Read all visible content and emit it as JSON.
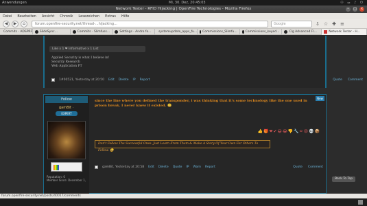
{
  "system": {
    "left_label": "Anwendungen",
    "clock": "Mi, 30. Dez, 20:45:03",
    "tray": "⚇ ⚍ ♪ ⏻"
  },
  "window": {
    "title": "Network Tester - RFID Hijacking | OpenFire Technologies - Mozilla Firefox"
  },
  "menu": [
    "Datei",
    "Bearbeiten",
    "Ansicht",
    "Chronik",
    "Lesezeichen",
    "Extras",
    "Hilfe"
  ],
  "nav": {
    "url": "forum.openfire-security.net/thread-...hijacking...",
    "search_placeholder": "Google"
  },
  "bookmarks": [
    {
      "label": "Commits · ADSPRF..."
    },
    {
      "label": "SlideSync..."
    },
    {
      "label": "Commits · Slimfuss..."
    },
    {
      "label": "Settings · Andro fo..."
    },
    {
      "label": "systemupdate_apps_fu..."
    },
    {
      "label": "Commissions_Slimfu..."
    },
    {
      "label": "Commissions_keyed..."
    },
    {
      "label": "Clg Advanced Fl..."
    },
    {
      "label": "Network Tester - H..."
    }
  ],
  "post1": {
    "like_bar": "Like x 1   ❤ Informative x 1   List",
    "signature": [
      "Applied Security is what I believe in!",
      "Security Research",
      "Web Application PT"
    ],
    "footer_meta": "1#00521, Yesterday at 20:50",
    "actions": [
      "Edit",
      "Delete",
      "IP",
      "Report"
    ],
    "right_actions": [
      "Quote",
      "Comment"
    ]
  },
  "post2": {
    "follow": "Follow",
    "username": "gamBit ·",
    "rank": "EXPERT",
    "new_badge": "New",
    "content": "since the line where you defined the transponder, i was thinking that it's some technology like the one used in prison break. I never knew it existed. 😀",
    "emojis": "👍🎁❤✔😀😂👎🔧✏😡💀📦",
    "signature": "Don't Follow The Successful Ones. Just Learn From Them & Make A Story Of Your Own For Others To Follow. 😀",
    "user_info": [
      "Reputation: 0",
      "Member Since: December 1,"
    ],
    "footer_meta": "gamBit, Yesterday at 20:58",
    "actions": [
      "Edit",
      "Delete",
      "Quote",
      "IP",
      "Warn",
      "Report"
    ],
    "right_actions": [
      "Quote",
      "Comment"
    ]
  },
  "back_to_top": "Back To Top",
  "status_url": "forum.openfire-security.net/posts/40017/comments"
}
